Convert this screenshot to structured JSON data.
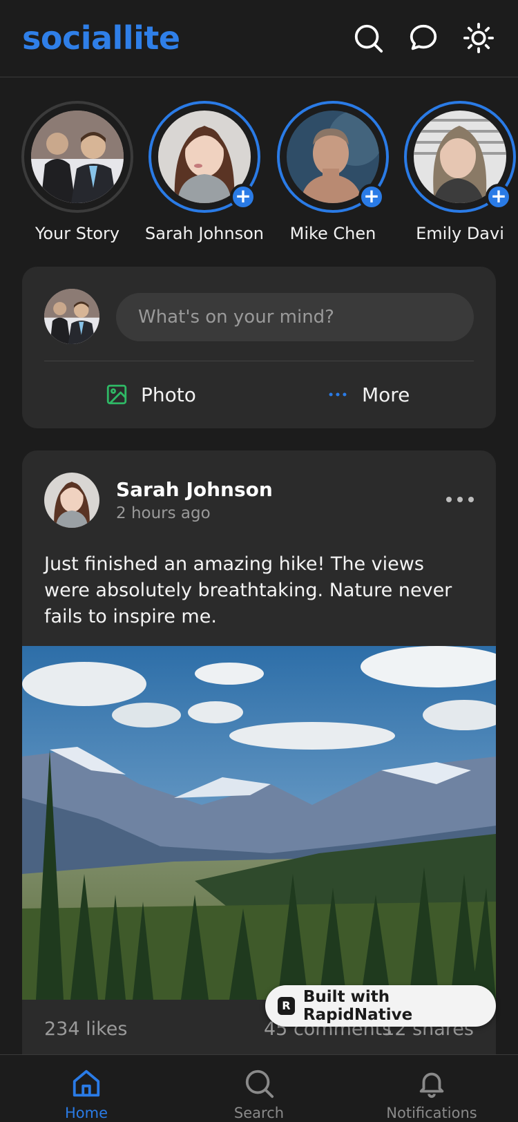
{
  "app": {
    "title": "sociallite",
    "accent": "#2a7be6"
  },
  "header": {
    "icons": [
      "search-icon",
      "message-circle-icon",
      "sun-icon"
    ]
  },
  "stories": [
    {
      "name": "Your Story",
      "active": false,
      "has_add": false
    },
    {
      "name": "Sarah Johnson",
      "active": true,
      "has_add": true
    },
    {
      "name": "Mike Chen",
      "active": true,
      "has_add": true
    },
    {
      "name": "Emily Davi",
      "active": true,
      "has_add": true
    }
  ],
  "composer": {
    "placeholder": "What's on your mind?",
    "photo_label": "Photo",
    "more_label": "More"
  },
  "post": {
    "author": "Sarah Johnson",
    "time": "2 hours ago",
    "text": "Just finished an amazing hike! The views were absolutely breathtaking. Nature never fails to inspire me.",
    "likes": "234 likes",
    "comments": "45 comments",
    "shares": "12 shares"
  },
  "badge": {
    "logo": "R",
    "text": "Built with RapidNative"
  },
  "nav": {
    "home": "Home",
    "search": "Search",
    "notifications": "Notifications"
  }
}
